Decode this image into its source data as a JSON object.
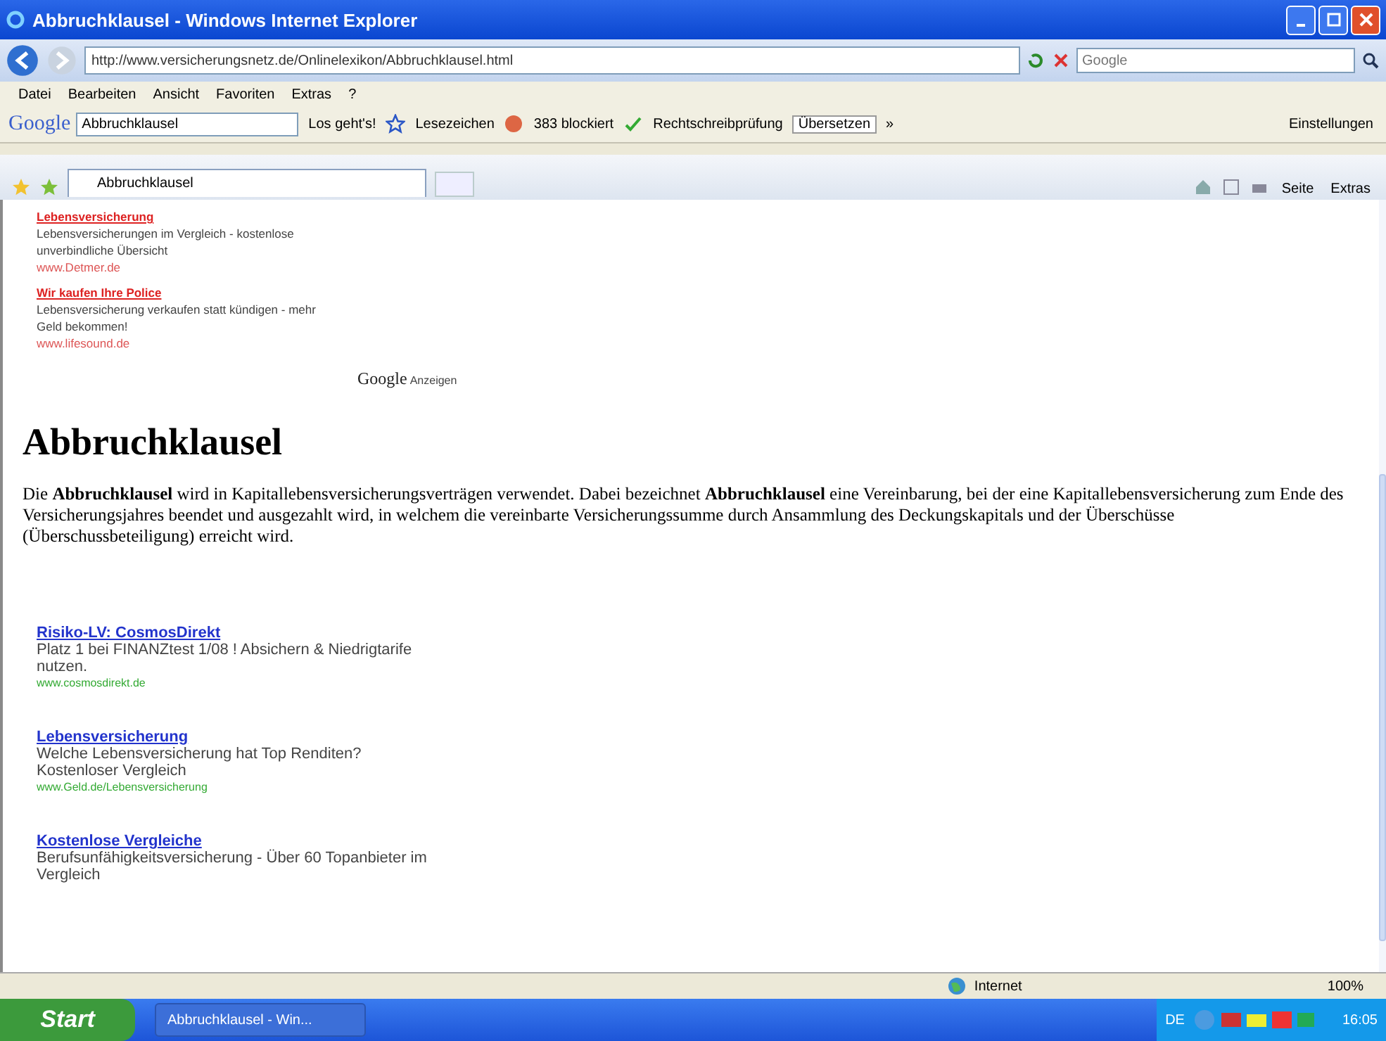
{
  "window": {
    "title": "Abbruchklausel - Windows Internet Explorer"
  },
  "address_bar": {
    "url": "http://www.versicherungsnetz.de/Onlinelexikon/Abbruchklausel.html",
    "search_placeholder": "Google"
  },
  "menu": [
    "Datei",
    "Bearbeiten",
    "Ansicht",
    "Favoriten",
    "Extras",
    "?"
  ],
  "google_toolbar": {
    "logo": "Google",
    "search_value": "Abbruchklausel",
    "go": "Los geht's!",
    "bookmarks": "Lesezeichen",
    "blocked": "383 blockiert",
    "spellcheck": "Rechtschreibprüfung",
    "translate": "Übersetzen",
    "more": "»",
    "settings": "Einstellungen"
  },
  "tab": {
    "label": "Abbruchklausel",
    "selected": true
  },
  "commands": [
    "Seite",
    "Extras"
  ],
  "top_ads": [
    {
      "title": "Lebensversicherung",
      "text": "Lebensversicherungen im Vergleich - kostenlose unverbindliche Übersicht",
      "url": "www.Detmer.de"
    },
    {
      "title": "Wir kaufen Ihre Police",
      "text": "Lebensversicherung verkaufen statt kündigen - mehr Geld bekommen!",
      "url": "www.lifesound.de"
    }
  ],
  "ads_label": {
    "logo": "Google",
    "text": "Anzeigen"
  },
  "heading": "Abbruchklausel",
  "paragraph": "Die **Abbruchklausel** wird in Kapitallebensversicherungsverträgen verwendet. Dabei bezeichnet **Abbruchklausel** eine Vereinbarung, bei der eine Kapitallebensversicherung zum Ende des Versicherungsjahres beendet und ausgezahlt wird, in welchem die vereinbarte Versicherungssumme durch Ansammlung des Deckungskapitals und der Überschüsse (Überschussbeteiligung) erreicht wird.",
  "bottom_ads": [
    {
      "title": "Risiko-LV: CosmosDirekt",
      "text": "Platz 1 bei FINANZtest 1/08 ! Absichern & Niedrigtarife nutzen.",
      "url": "www.cosmosdirekt.de"
    },
    {
      "title": "Lebensversicherung",
      "text": "Welche Lebensversicherung hat Top Renditen? Kostenloser Vergleich",
      "url": "www.Geld.de/Lebensversicherung"
    },
    {
      "title": "Kostenlose Vergleiche",
      "text": "Berufsunfähigkeitsversicherung - Über 60 Topanbieter im Vergleich"
    }
  ],
  "status_bar": {
    "zone": "Internet",
    "zoom": "100%"
  },
  "taskbar": {
    "start": "Start",
    "task": "Abbruchklausel - Win...",
    "language": "DE",
    "clock": "16:05"
  }
}
